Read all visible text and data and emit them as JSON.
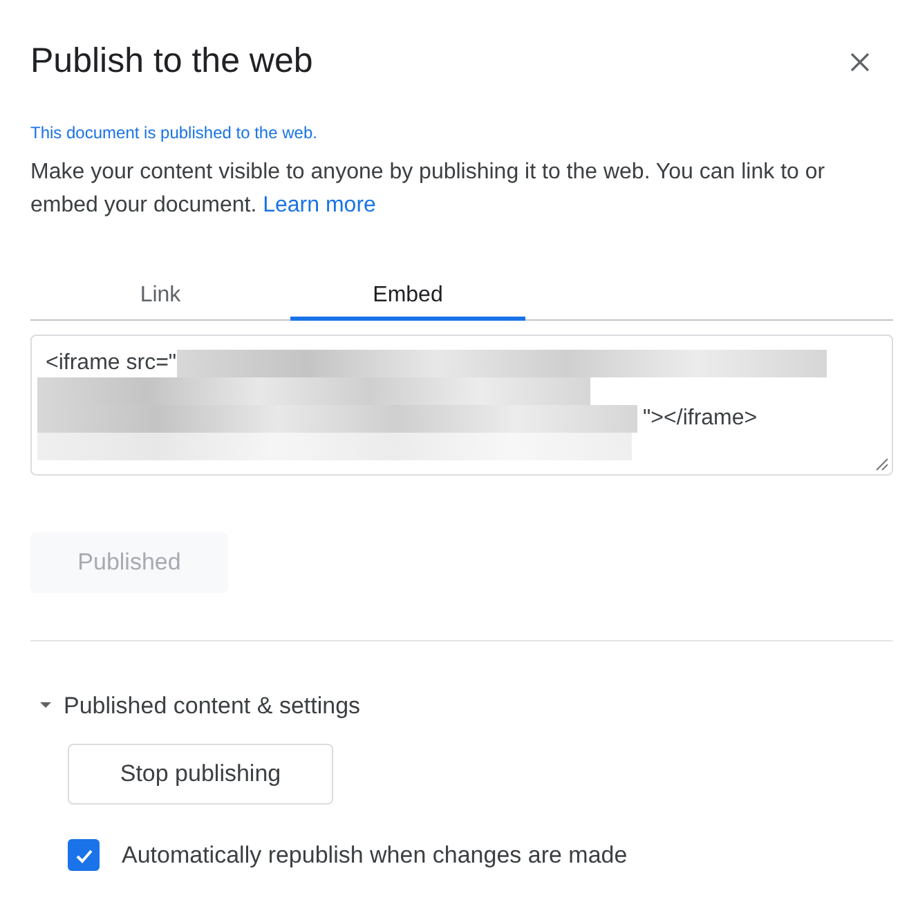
{
  "dialog": {
    "title": "Publish to the web"
  },
  "status_note": "This document is published to the web.",
  "description": {
    "text": "Make your content visible to anyone by publishing it to the web. You can link to or embed your document.",
    "link": "Learn more"
  },
  "tabs": [
    {
      "label": "Link",
      "selected": false
    },
    {
      "label": "Embed",
      "selected": true
    }
  ],
  "embed_code": {
    "start": "<iframe src=\"",
    "end": "\"></iframe>"
  },
  "publish_button": {
    "label": "Published",
    "disabled": true
  },
  "settings": {
    "label": "Published content & settings",
    "expanded": true,
    "stop_button": "Stop publishing",
    "auto_republish": {
      "label": "Automatically republish when changes are made",
      "checked": true
    }
  }
}
